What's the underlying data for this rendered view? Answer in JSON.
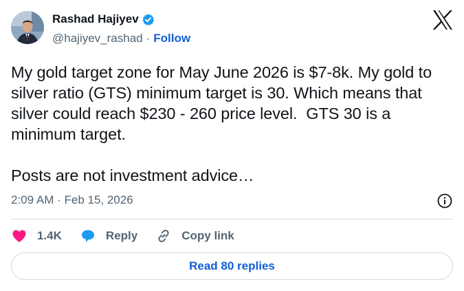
{
  "author": {
    "name": "Rashad Hajiyev",
    "handle": "@hajiyev_rashad",
    "separator": "·",
    "follow_label": "Follow",
    "verified_color": "#1d9bf0"
  },
  "tweet": {
    "text": "My gold target zone for May June 2026 is $7-8k. My gold to silver ratio (GTS) minimum target is 30. Which means that silver could reach $230 - 260 price level.  GTS 30 is a minimum target.\n\nPosts are not investment advice…",
    "timestamp": "2:09 AM · Feb 15, 2026"
  },
  "actions": {
    "likes": "1.4K",
    "reply_label": "Reply",
    "copy_link_label": "Copy link"
  },
  "read_replies_label": "Read 80 replies",
  "colors": {
    "like": "#f91880",
    "reply": "#1d9bf0",
    "link_blue": "#0f5fd6",
    "muted": "#536471"
  }
}
